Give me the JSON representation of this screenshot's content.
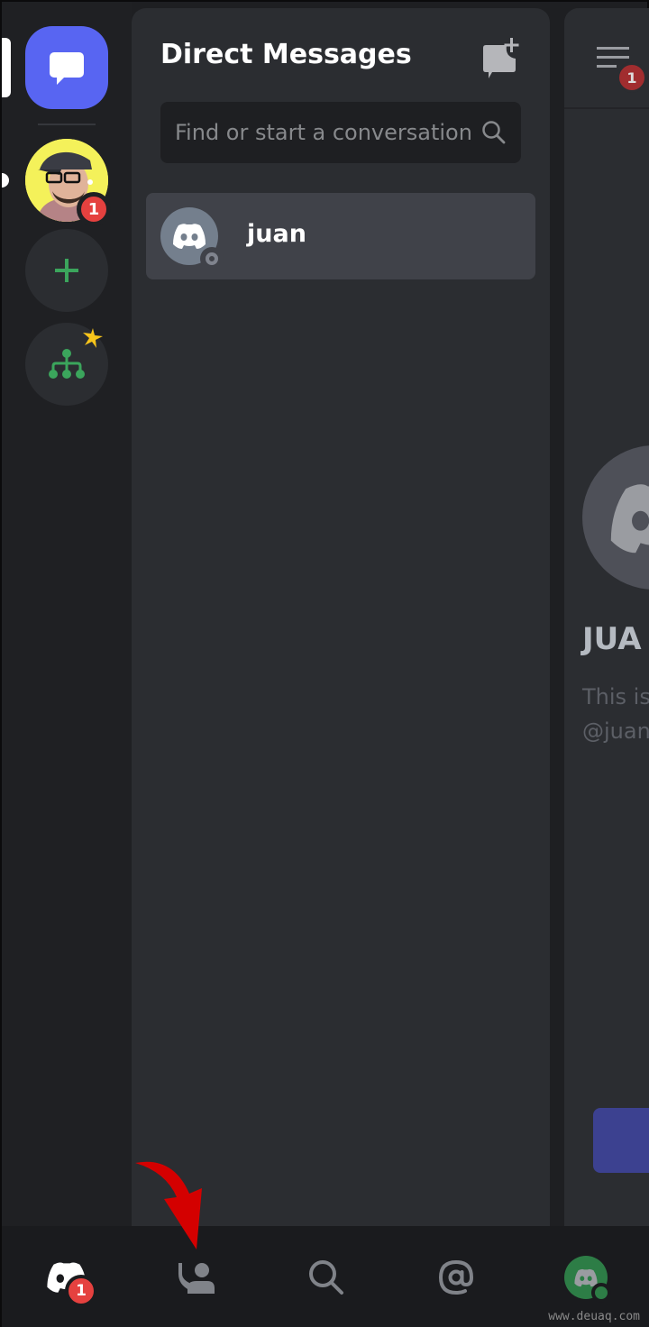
{
  "rail": {
    "server_badge": "1",
    "items": [
      {
        "name": "direct-messages",
        "icon": "chat-bubble-icon"
      },
      {
        "name": "user-server",
        "icon": "avatar-photo"
      },
      {
        "name": "add-server",
        "icon": "plus-icon"
      },
      {
        "name": "explore-servers",
        "icon": "hub-tree-icon"
      }
    ]
  },
  "dm_panel": {
    "title": "Direct Messages",
    "new_dm_icon": "new-dm-icon",
    "search": {
      "placeholder": "Find or start a conversation"
    },
    "conversations": [
      {
        "name": "juan",
        "status": "offline"
      }
    ]
  },
  "chat": {
    "menu_badge": "1",
    "name_partial": "JUA",
    "intro_line1": "This is",
    "intro_line2": "@juan"
  },
  "bottom_nav": {
    "items": [
      {
        "name": "home",
        "icon": "discord-logo-icon",
        "badge": "1"
      },
      {
        "name": "friends",
        "icon": "friends-icon"
      },
      {
        "name": "search",
        "icon": "search-icon"
      },
      {
        "name": "mentions",
        "icon": "at-icon"
      },
      {
        "name": "profile",
        "icon": "avatar-icon"
      }
    ],
    "watermark": "www.deuaq.com"
  },
  "colors": {
    "blurple": "#5865f2",
    "badge_red": "#e5413f",
    "green": "#3ba55c",
    "annotation_arrow": "#d40000"
  }
}
